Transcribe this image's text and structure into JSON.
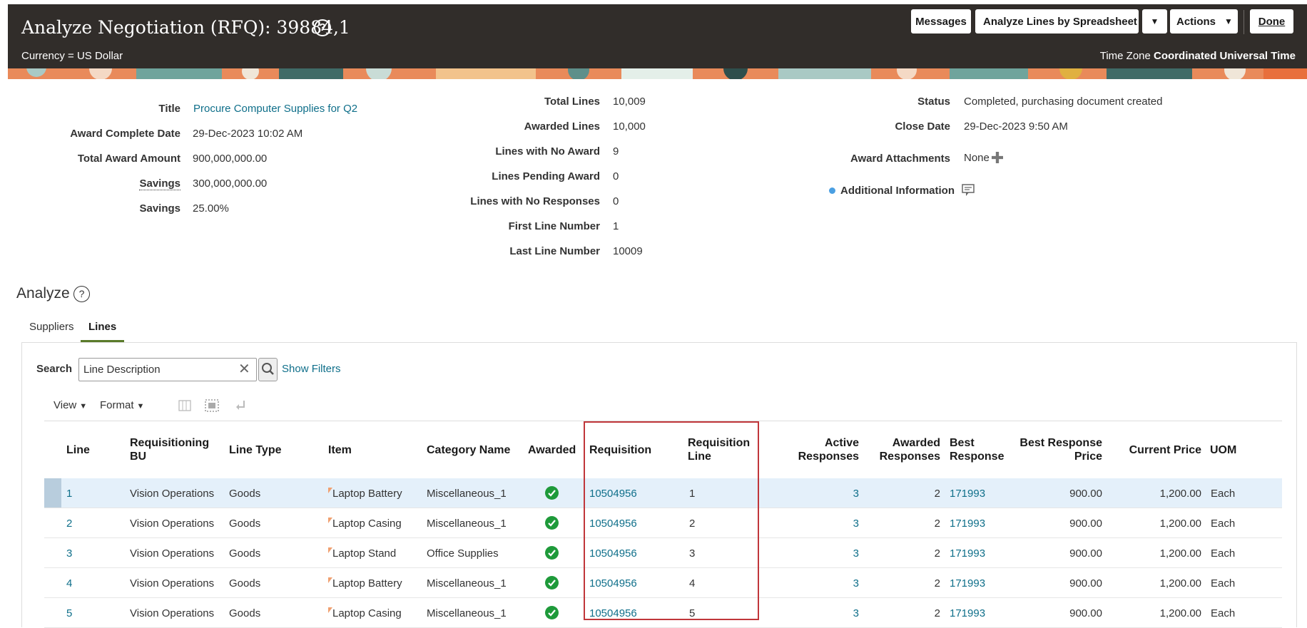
{
  "header": {
    "title": "Analyze Negotiation (RFQ): 39884,1",
    "currency": "Currency = US Dollar",
    "timezone_label": "Time Zone",
    "timezone_value": "Coordinated Universal Time",
    "buttons": {
      "messages": "Messages",
      "analyze_lines": "Analyze Lines by Spreadsheet",
      "actions": "Actions",
      "done": "Done"
    }
  },
  "summary": {
    "col1": [
      {
        "label": "Title",
        "value": "Procure Computer Supplies for Q2"
      },
      {
        "label": "Award Complete Date",
        "value": "29-Dec-2023 10:02 AM"
      },
      {
        "label": "Total Award Amount",
        "value": "900,000,000.00"
      },
      {
        "label": "Savings",
        "value": "300,000,000.00"
      },
      {
        "label": "Savings",
        "value": "25.00%"
      }
    ],
    "col2": [
      {
        "label": "Total Lines",
        "value": "10,009"
      },
      {
        "label": "Awarded Lines",
        "value": "10,000"
      },
      {
        "label": "Lines with No Award",
        "value": "9"
      },
      {
        "label": "Lines Pending Award",
        "value": "0"
      },
      {
        "label": "Lines with No Responses",
        "value": "0"
      },
      {
        "label": "First Line Number",
        "value": "1"
      },
      {
        "label": "Last Line Number",
        "value": "10009"
      }
    ],
    "col3": [
      {
        "label": "Status",
        "value": "Completed, purchasing document created"
      },
      {
        "label": "Close Date",
        "value": "29-Dec-2023 9:50 AM"
      },
      {
        "label": "Award Attachments",
        "value": "None"
      },
      {
        "label": "Additional Information",
        "value": ""
      }
    ]
  },
  "analyze": {
    "title": "Analyze",
    "tabs": [
      "Suppliers",
      "Lines"
    ],
    "search_label": "Search",
    "search_value": "Line Description",
    "show_filters": "Show Filters",
    "view": "View",
    "format": "Format"
  },
  "table": {
    "headers": {
      "line": "Line",
      "bu1": "Requisitioning",
      "bu2": "BU",
      "line_type": "Line Type",
      "item": "Item",
      "category": "Category Name",
      "awarded": "Awarded",
      "requisition": "Requisition",
      "req_line1": "Requisition",
      "req_line2": "Line",
      "active1": "Active",
      "active2": "Responses",
      "awarded_resp1": "Awarded",
      "awarded_resp2": "Responses",
      "best1": "Best",
      "best2": "Response",
      "best_price1": "Best Response",
      "best_price2": "Price",
      "current_price": "Current Price",
      "uom": "UOM"
    },
    "rows": [
      {
        "line": "1",
        "bu": "Vision Operations",
        "line_type": "Goods",
        "item": "Laptop Battery",
        "category": "Miscellaneous_1",
        "awarded": true,
        "requisition": "10504956",
        "req_line": "1",
        "active": "3",
        "awarded_resp": "2",
        "best": "171993",
        "best_price": "900.00",
        "current_price": "1,200.00",
        "uom": "Each"
      },
      {
        "line": "2",
        "bu": "Vision Operations",
        "line_type": "Goods",
        "item": "Laptop Casing",
        "category": "Miscellaneous_1",
        "awarded": true,
        "requisition": "10504956",
        "req_line": "2",
        "active": "3",
        "awarded_resp": "2",
        "best": "171993",
        "best_price": "900.00",
        "current_price": "1,200.00",
        "uom": "Each"
      },
      {
        "line": "3",
        "bu": "Vision Operations",
        "line_type": "Goods",
        "item": "Laptop Stand",
        "category": "Office Supplies",
        "awarded": true,
        "requisition": "10504956",
        "req_line": "3",
        "active": "3",
        "awarded_resp": "2",
        "best": "171993",
        "best_price": "900.00",
        "current_price": "1,200.00",
        "uom": "Each"
      },
      {
        "line": "4",
        "bu": "Vision Operations",
        "line_type": "Goods",
        "item": "Laptop Battery",
        "category": "Miscellaneous_1",
        "awarded": true,
        "requisition": "10504956",
        "req_line": "4",
        "active": "3",
        "awarded_resp": "2",
        "best": "171993",
        "best_price": "900.00",
        "current_price": "1,200.00",
        "uom": "Each"
      },
      {
        "line": "5",
        "bu": "Vision Operations",
        "line_type": "Goods",
        "item": "Laptop Casing",
        "category": "Miscellaneous_1",
        "awarded": true,
        "requisition": "10504956",
        "req_line": "5",
        "active": "3",
        "awarded_resp": "2",
        "best": "171993",
        "best_price": "900.00",
        "current_price": "1,200.00",
        "uom": "Each"
      }
    ]
  },
  "colors": {
    "header_bg": "#312d2a",
    "link": "#0f6f8a",
    "awarded_check": "#1e9a3a",
    "highlight_box": "#c0363a",
    "selected_row": "#e4f0fa"
  }
}
